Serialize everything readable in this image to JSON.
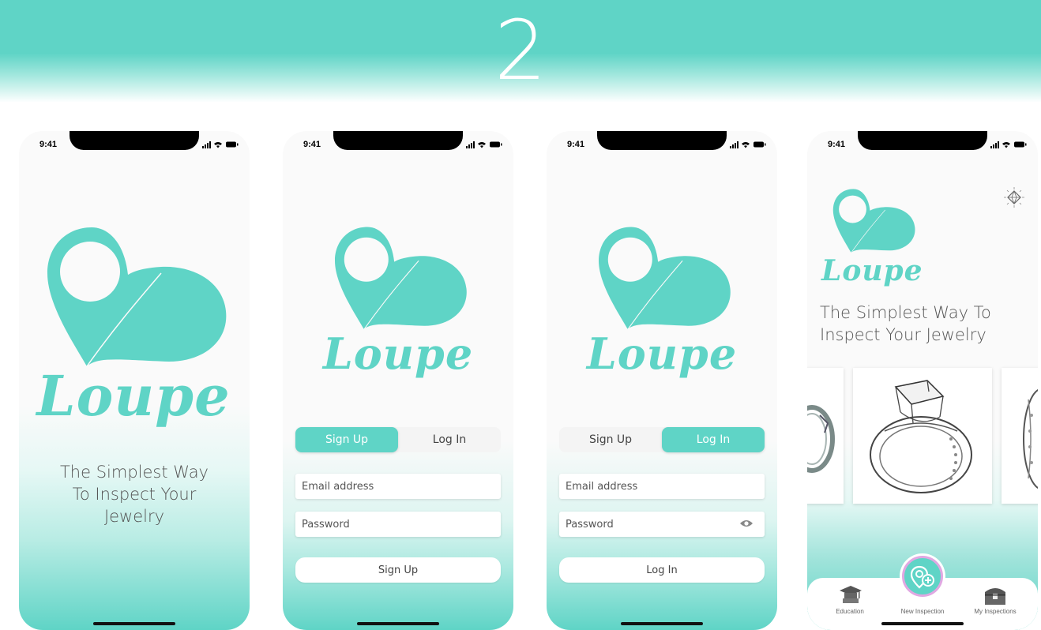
{
  "banner": {
    "step_number": "2"
  },
  "status_bar": {
    "time": "9:41"
  },
  "brand": {
    "name": "Loupe"
  },
  "splash": {
    "tagline_line1": "The Simplest Way",
    "tagline_line2": "To Inspect Your",
    "tagline_line3": "Jewelry"
  },
  "signup_screen": {
    "tabs": [
      {
        "label": "Sign Up",
        "active": true
      },
      {
        "label": "Log In",
        "active": false
      }
    ],
    "email_placeholder": "Email address",
    "password_placeholder": "Password",
    "submit_label": "Sign Up"
  },
  "login_screen": {
    "tabs": [
      {
        "label": "Sign Up",
        "active": false
      },
      {
        "label": "Log In",
        "active": true
      }
    ],
    "email_placeholder": "Email address",
    "password_placeholder": "Password",
    "submit_label": "Log In"
  },
  "home_screen": {
    "tagline_line1": "The Simplest Way To",
    "tagline_line2": "Inspect Your Jewelry",
    "tabs": [
      {
        "label": "Education",
        "icon": "graduation-cap-icon"
      },
      {
        "label": "New Inspection",
        "icon": "add-location-icon"
      },
      {
        "label": "My Inspections",
        "icon": "treasure-chest-icon"
      }
    ]
  },
  "colors": {
    "accent": "#5fd4c6",
    "fab_ring": "#e0a8e2"
  }
}
